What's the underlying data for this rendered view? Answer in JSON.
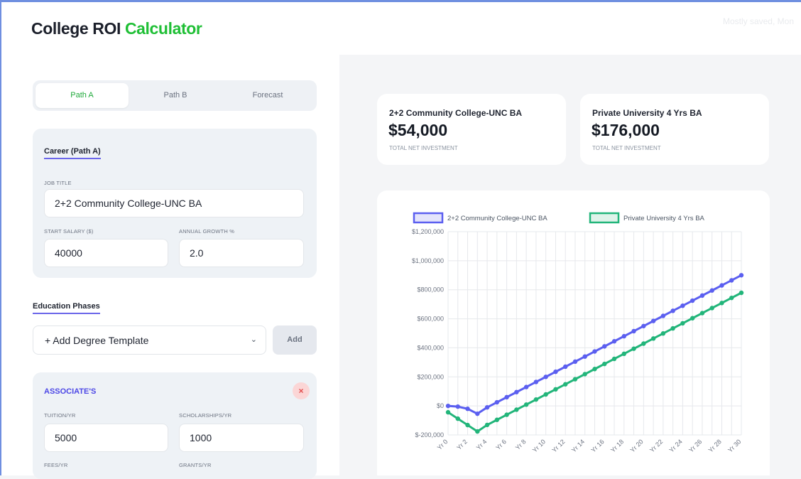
{
  "app": {
    "title_part1": "College ROI",
    "title_part2": "Calculator",
    "header_right": "Mostly saved, Mon"
  },
  "tabs": [
    {
      "label": "Path A",
      "active": true
    },
    {
      "label": "Path B",
      "active": false
    },
    {
      "label": "Forecast",
      "active": false
    }
  ],
  "career": {
    "title": "Career (Path A)",
    "job_title_label": "JOB TITLE",
    "job_title_value": "2+2 Community College-UNC BA",
    "start_salary_label": "START SALARY ($)",
    "start_salary_value": "40000",
    "growth_label": "ANNUAL GROWTH %",
    "growth_value": "2.0"
  },
  "education": {
    "title": "Education Phases",
    "template_select": "+ Add Degree Template",
    "add_label": "Add",
    "phase": {
      "title": "ASSOCIATE'S",
      "remove_label": "×",
      "tuition_label": "TUITION/YR",
      "tuition_value": "5000",
      "scholarships_label": "SCHOLARSHIPS/YR",
      "scholarships_value": "1000",
      "fees_label": "FEES/YR",
      "grants_label": "GRANTS/YR"
    }
  },
  "summary": [
    {
      "name": "2+2 Community College-UNC BA",
      "value": "$54,000",
      "sub": "TOTAL NET INVESTMENT"
    },
    {
      "name": "Private University 4 Yrs BA",
      "value": "$176,000",
      "sub": "TOTAL NET INVESTMENT"
    }
  ],
  "chart_data": {
    "type": "line",
    "title": "",
    "xlabel": "",
    "ylabel": "",
    "x": [
      0,
      1,
      2,
      3,
      4,
      5,
      6,
      7,
      8,
      9,
      10,
      11,
      12,
      13,
      14,
      15,
      16,
      17,
      18,
      19,
      20,
      21,
      22,
      23,
      24,
      25,
      26,
      27,
      28,
      29,
      30
    ],
    "x_tick_labels": [
      "Yr 0",
      "Yr 2",
      "Yr 4",
      "Yr 6",
      "Yr 8",
      "Yr 10",
      "Yr 12",
      "Yr 14",
      "Yr 16",
      "Yr 18",
      "Yr 20",
      "Yr 22",
      "Yr 24",
      "Yr 26",
      "Yr 28",
      "Yr 30"
    ],
    "y_ticks": [
      -200000,
      0,
      200000,
      400000,
      600000,
      800000,
      1000000,
      1200000
    ],
    "y_tick_labels": [
      "$-200,000",
      "$0",
      "$200,000",
      "$400,000",
      "$600,000",
      "$800,000",
      "$1,000,000",
      "$1,200,000"
    ],
    "ylim": [
      -200000,
      1200000
    ],
    "grid": true,
    "legend_position": "top",
    "series": [
      {
        "name": "2+2 Community College-UNC BA",
        "color": "#5b5ff0",
        "fill": "#e4e4fb",
        "values": [
          0,
          -5000,
          -20000,
          -54000,
          -10000,
          25000,
          60000,
          95000,
          130000,
          165000,
          200000,
          235000,
          270000,
          305000,
          340000,
          375000,
          410000,
          445000,
          480000,
          515000,
          550000,
          585000,
          620000,
          655000,
          690000,
          725000,
          760000,
          795000,
          830000,
          865000,
          900000
        ]
      },
      {
        "name": "Private University 4 Yrs BA",
        "color": "#22b57a",
        "fill": "#dff3ea",
        "values": [
          -44000,
          -88000,
          -132000,
          -176000,
          -131000,
          -96000,
          -61000,
          -26000,
          9000,
          44000,
          79000,
          114000,
          149000,
          184000,
          219000,
          254000,
          289000,
          324000,
          359000,
          394000,
          429000,
          464000,
          499000,
          534000,
          569000,
          604000,
          639000,
          674000,
          709000,
          744000,
          779000
        ]
      }
    ]
  }
}
